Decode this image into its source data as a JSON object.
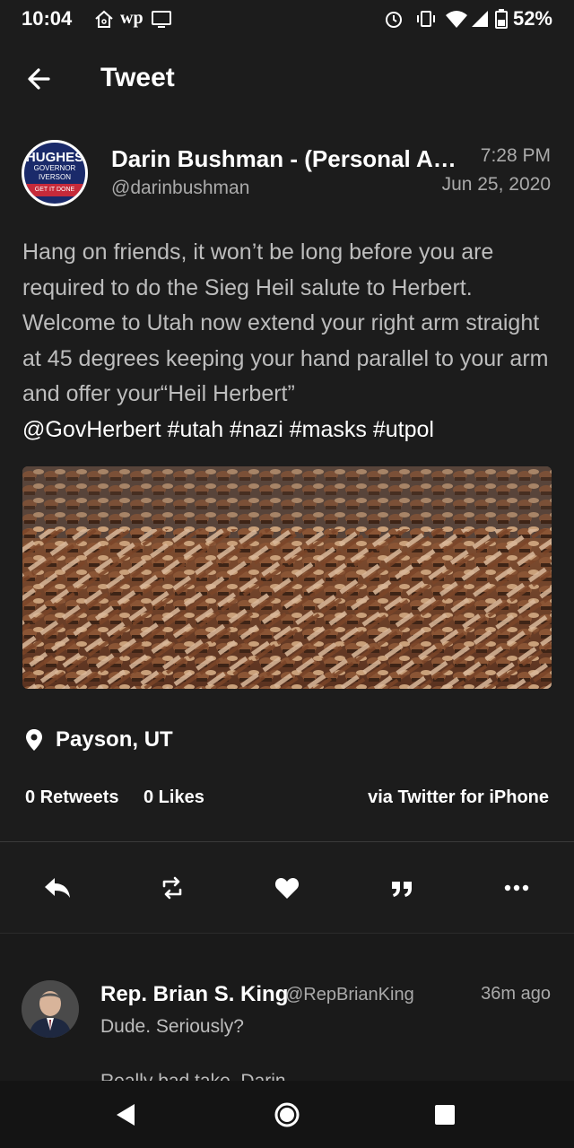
{
  "status_bar": {
    "time": "10:04",
    "battery": "52%",
    "icons": [
      "home-icon",
      "wapo-icon",
      "cast-icon",
      "alarm-icon",
      "vibrate-icon",
      "wifi-icon",
      "signal-icon",
      "battery-icon"
    ],
    "wapo_label": "wp"
  },
  "app_bar": {
    "title": "Tweet"
  },
  "tweet": {
    "author_name": "Darin Bushman - (Personal Acco...",
    "author_handle": "@darinbushman",
    "time": "7:28 PM",
    "date": "Jun 25, 2020",
    "avatar_text": {
      "line1": "HUGHES",
      "line2": "GOVERNOR",
      "line3": "IVERSON",
      "line4": "GET IT DONE"
    },
    "body": "Hang on friends, it won’t be long before you are required to do the Sieg Heil salute to Herbert. Welcome to Utah now extend your right arm straight at 45 degrees keeping your hand parallel to your arm and offer your“Heil Herbert”",
    "tags": "@GovHerbert  #utah #nazi #masks #utpol",
    "location": "Payson, UT",
    "retweets": "0 Retweets",
    "likes": "0 Likes",
    "via": "via Twitter for iPhone"
  },
  "actions": [
    "reply-icon",
    "retweet-icon",
    "like-icon",
    "quote-icon",
    "more-icon"
  ],
  "reply": {
    "name": "Rep. Brian S. King",
    "handle": "@RepBrianKing",
    "time": "36m ago",
    "text": "Dude. Seriously?",
    "text_2": "Really bad take, Darin."
  },
  "nav": [
    "back-nav-icon",
    "home-nav-icon",
    "recents-nav-icon"
  ],
  "colors": {
    "background": "#1c1c1c",
    "secondary_text": "#aaaaaa",
    "body_text": "#bdbdbd"
  }
}
